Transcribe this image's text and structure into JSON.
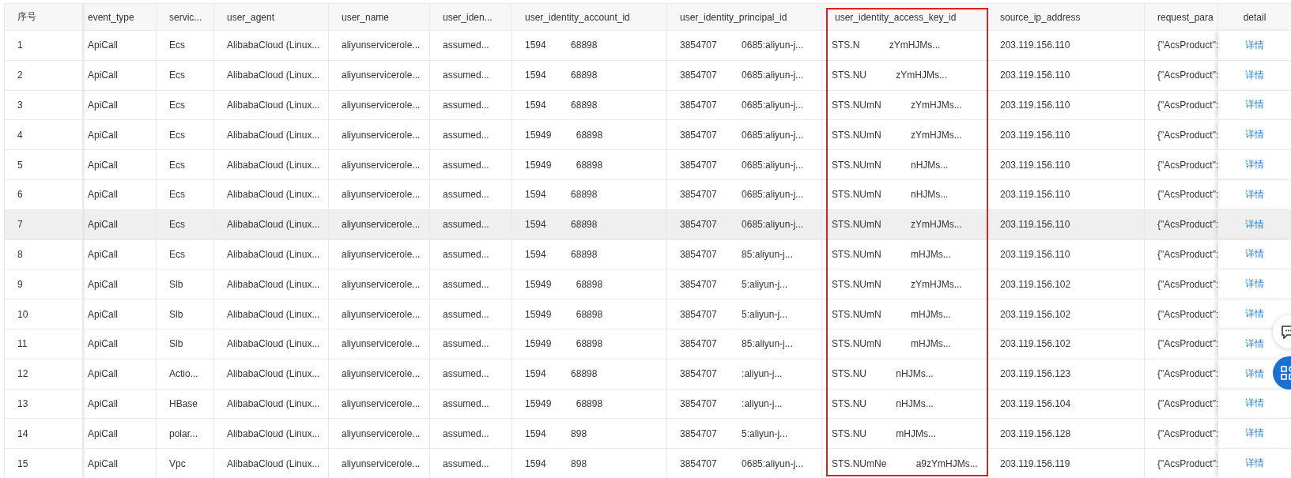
{
  "table": {
    "columns": [
      {
        "label": "序号",
        "highlighted": false
      },
      {
        "label": "event_type",
        "highlighted": false
      },
      {
        "label": "servic...",
        "highlighted": false
      },
      {
        "label": "user_agent",
        "highlighted": false
      },
      {
        "label": "user_name",
        "highlighted": false
      },
      {
        "label": "user_iden...",
        "highlighted": false
      },
      {
        "label": "user_identity_account_id",
        "highlighted": false
      },
      {
        "label": "user_identity_principal_id",
        "highlighted": false
      },
      {
        "label": "user_identity_access_key_id",
        "highlighted": true
      },
      {
        "label": "source_ip_address",
        "highlighted": false
      },
      {
        "label": "request_para",
        "highlighted": false
      },
      {
        "label": "detail",
        "highlighted": false
      }
    ],
    "rows": [
      {
        "no": "1",
        "event_type": "ApiCall",
        "service": "Ecs",
        "user_agent": "AlibabaCloud (Linux...",
        "user_name": "aliyunservicerole...",
        "user_identity": "assumed...",
        "account_id": [
          "1594",
          "68898"
        ],
        "principal_id": [
          "3854707",
          "0685:aliyun-j..."
        ],
        "access_key_id": [
          "STS.N",
          "zYmHJMs..."
        ],
        "source_ip": "203.119.156.110",
        "request_param": "{\"AcsProduct\":",
        "detail": "详情",
        "hovered": false
      },
      {
        "no": "2",
        "event_type": "ApiCall",
        "service": "Ecs",
        "user_agent": "AlibabaCloud (Linux...",
        "user_name": "aliyunservicerole...",
        "user_identity": "assumed...",
        "account_id": [
          "1594",
          "68898"
        ],
        "principal_id": [
          "3854707",
          "0685:aliyun-j..."
        ],
        "access_key_id": [
          "STS.NU",
          "zYmHJMs..."
        ],
        "source_ip": "203.119.156.110",
        "request_param": "{\"AcsProduct\":",
        "detail": "详情",
        "hovered": false
      },
      {
        "no": "3",
        "event_type": "ApiCall",
        "service": "Ecs",
        "user_agent": "AlibabaCloud (Linux...",
        "user_name": "aliyunservicerole...",
        "user_identity": "assumed...",
        "account_id": [
          "1594",
          "68898"
        ],
        "principal_id": [
          "3854707",
          "0685:aliyun-j..."
        ],
        "access_key_id": [
          "STS.NUmN",
          "zYmHJMs..."
        ],
        "source_ip": "203.119.156.110",
        "request_param": "{\"AcsProduct\":",
        "detail": "详情",
        "hovered": false
      },
      {
        "no": "4",
        "event_type": "ApiCall",
        "service": "Ecs",
        "user_agent": "AlibabaCloud (Linux...",
        "user_name": "aliyunservicerole...",
        "user_identity": "assumed...",
        "account_id": [
          "15949",
          "68898"
        ],
        "principal_id": [
          "3854707",
          "0685:aliyun-j..."
        ],
        "access_key_id": [
          "STS.NUmN",
          "zYmHJMs..."
        ],
        "source_ip": "203.119.156.110",
        "request_param": "{\"AcsProduct\":",
        "detail": "详情",
        "hovered": false
      },
      {
        "no": "5",
        "event_type": "ApiCall",
        "service": "Ecs",
        "user_agent": "AlibabaCloud (Linux...",
        "user_name": "aliyunservicerole...",
        "user_identity": "assumed...",
        "account_id": [
          "15949",
          "68898"
        ],
        "principal_id": [
          "3854707",
          "0685:aliyun-j..."
        ],
        "access_key_id": [
          "STS.NUmN",
          "nHJMs..."
        ],
        "source_ip": "203.119.156.110",
        "request_param": "{\"AcsProduct\":",
        "detail": "详情",
        "hovered": false
      },
      {
        "no": "6",
        "event_type": "ApiCall",
        "service": "Ecs",
        "user_agent": "AlibabaCloud (Linux...",
        "user_name": "aliyunservicerole...",
        "user_identity": "assumed...",
        "account_id": [
          "1594",
          "68898"
        ],
        "principal_id": [
          "3854707",
          "0685:aliyun-j..."
        ],
        "access_key_id": [
          "STS.NUmN",
          "nHJMs..."
        ],
        "source_ip": "203.119.156.110",
        "request_param": "{\"AcsProduct\":",
        "detail": "详情",
        "hovered": false
      },
      {
        "no": "7",
        "event_type": "ApiCall",
        "service": "Ecs",
        "user_agent": "AlibabaCloud (Linux...",
        "user_name": "aliyunservicerole...",
        "user_identity": "assumed...",
        "account_id": [
          "1594",
          "68898"
        ],
        "principal_id": [
          "3854707",
          "0685:aliyun-j..."
        ],
        "access_key_id": [
          "STS.NUmN",
          "zYmHJMs..."
        ],
        "source_ip": "203.119.156.110",
        "request_param": "{\"AcsProduct\":",
        "detail": "详情",
        "hovered": true
      },
      {
        "no": "8",
        "event_type": "ApiCall",
        "service": "Ecs",
        "user_agent": "AlibabaCloud (Linux...",
        "user_name": "aliyunservicerole...",
        "user_identity": "assumed...",
        "account_id": [
          "1594",
          "68898"
        ],
        "principal_id": [
          "3854707",
          "85:aliyun-j..."
        ],
        "access_key_id": [
          "STS.NUmN",
          "mHJMs..."
        ],
        "source_ip": "203.119.156.110",
        "request_param": "{\"AcsProduct\":",
        "detail": "详情",
        "hovered": false
      },
      {
        "no": "9",
        "event_type": "ApiCall",
        "service": "Slb",
        "user_agent": "AlibabaCloud (Linux...",
        "user_name": "aliyunservicerole...",
        "user_identity": "assumed...",
        "account_id": [
          "15949",
          "68898"
        ],
        "principal_id": [
          "3854707",
          "5:aliyun-j..."
        ],
        "access_key_id": [
          "STS.NUmN",
          "zYmHJMs..."
        ],
        "source_ip": "203.119.156.102",
        "request_param": "{\"AcsProduct\":",
        "detail": "详情",
        "hovered": false
      },
      {
        "no": "10",
        "event_type": "ApiCall",
        "service": "Slb",
        "user_agent": "AlibabaCloud (Linux...",
        "user_name": "aliyunservicerole...",
        "user_identity": "assumed...",
        "account_id": [
          "15949",
          "68898"
        ],
        "principal_id": [
          "3854707",
          "5:aliyun-j..."
        ],
        "access_key_id": [
          "STS.NUmN",
          "mHJMs..."
        ],
        "source_ip": "203.119.156.102",
        "request_param": "{\"AcsProduct\":",
        "detail": "详情",
        "hovered": false
      },
      {
        "no": "11",
        "event_type": "ApiCall",
        "service": "Slb",
        "user_agent": "AlibabaCloud (Linux...",
        "user_name": "aliyunservicerole...",
        "user_identity": "assumed...",
        "account_id": [
          "15949",
          "68898"
        ],
        "principal_id": [
          "3854707",
          "85:aliyun-j..."
        ],
        "access_key_id": [
          "STS.NUmN",
          "mHJMs..."
        ],
        "source_ip": "203.119.156.102",
        "request_param": "{\"AcsProduct\":",
        "detail": "详情",
        "hovered": false
      },
      {
        "no": "12",
        "event_type": "ApiCall",
        "service": "Actio...",
        "user_agent": "AlibabaCloud (Linux...",
        "user_name": "aliyunservicerole...",
        "user_identity": "assumed...",
        "account_id": [
          "1594",
          "68898"
        ],
        "principal_id": [
          "3854707",
          ":aliyun-j..."
        ],
        "access_key_id": [
          "STS.NU",
          "nHJMs..."
        ],
        "source_ip": "203.119.156.123",
        "request_param": "{\"AcsProduct\":",
        "detail": "详情",
        "hovered": false
      },
      {
        "no": "13",
        "event_type": "ApiCall",
        "service": "HBase",
        "user_agent": "AlibabaCloud (Linux...",
        "user_name": "aliyunservicerole...",
        "user_identity": "assumed...",
        "account_id": [
          "15949",
          "68898"
        ],
        "principal_id": [
          "3854707",
          ":aliyun-j..."
        ],
        "access_key_id": [
          "STS.NU",
          "nHJMs..."
        ],
        "source_ip": "203.119.156.104",
        "request_param": "{\"AcsProduct\":",
        "detail": "详情",
        "hovered": false
      },
      {
        "no": "14",
        "event_type": "ApiCall",
        "service": "polar...",
        "user_agent": "AlibabaCloud (Linux...",
        "user_name": "aliyunservicerole...",
        "user_identity": "assumed...",
        "account_id": [
          "1594",
          "898"
        ],
        "principal_id": [
          "3854707",
          "5:aliyun-j..."
        ],
        "access_key_id": [
          "STS.NU",
          "mHJMs..."
        ],
        "source_ip": "203.119.156.128",
        "request_param": "{\"AcsProduct\":",
        "detail": "详情",
        "hovered": false
      },
      {
        "no": "15",
        "event_type": "ApiCall",
        "service": "Vpc",
        "user_agent": "AlibabaCloud (Linux...",
        "user_name": "aliyunservicerole...",
        "user_identity": "assumed...",
        "account_id": [
          "1594",
          "898"
        ],
        "principal_id": [
          "3854707",
          "0685:aliyun-j..."
        ],
        "access_key_id": [
          "STS.NUmNe",
          "a9zYmHJMs..."
        ],
        "source_ip": "203.119.156.119",
        "request_param": "{\"AcsProduct\":",
        "detail": "详情",
        "hovered": false
      }
    ]
  }
}
